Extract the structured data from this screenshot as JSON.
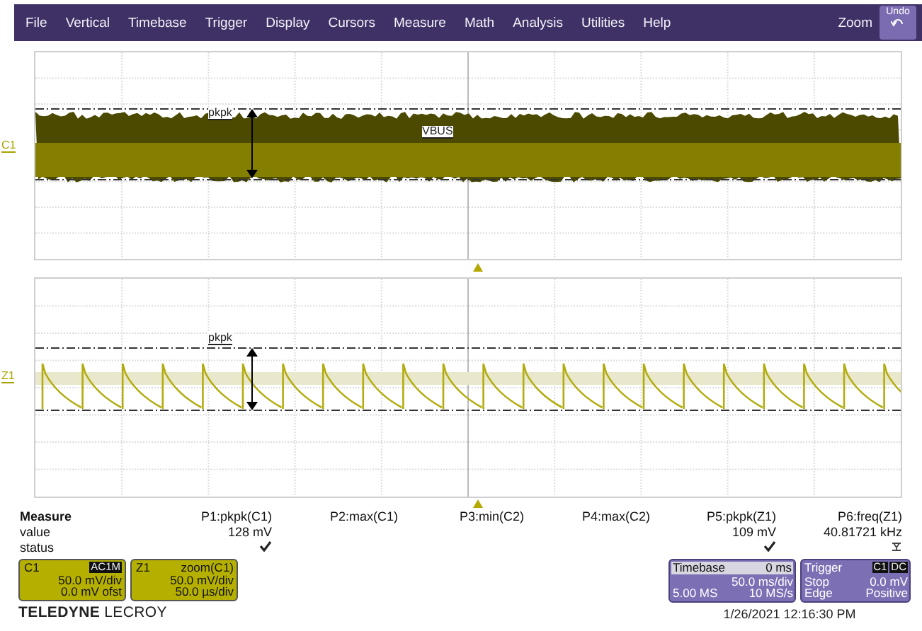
{
  "menu": {
    "items": [
      "File",
      "Vertical",
      "Timebase",
      "Trigger",
      "Display",
      "Cursors",
      "Measure",
      "Math",
      "Analysis",
      "Utilities",
      "Help"
    ],
    "zoom": "Zoom",
    "undo": "Undo"
  },
  "panels": [
    {
      "trace": "C1",
      "kind": "noise",
      "annotations": [
        {
          "text": "pkpk",
          "kind": "measure"
        },
        {
          "text": "VBUS",
          "kind": "trace"
        }
      ]
    },
    {
      "trace": "Z1",
      "kind": "sawtooth",
      "annotations": [
        {
          "text": "pkpk",
          "kind": "measure"
        }
      ]
    }
  ],
  "measure": {
    "title": "Measure",
    "row_labels": [
      "value",
      "status"
    ],
    "params": [
      {
        "name": "P1:pkpk(C1)",
        "value": "128 mV",
        "kind": "check"
      },
      {
        "name": "P2:max(C1)",
        "kind": "plain"
      },
      {
        "name": "P3:min(C2)",
        "kind": "plain"
      },
      {
        "name": "P4:max(C2)",
        "kind": "plain"
      },
      {
        "name": "P5:pkpk(Z1)",
        "value": "109 mV",
        "kind": "check"
      },
      {
        "name": "P6:freq(Z1)",
        "value": "40.81721 kHz",
        "kind": "unstable"
      }
    ]
  },
  "channel_badges": [
    {
      "name": "C1",
      "tag": "AC1M",
      "lines": [
        "50.0 mV/div",
        "0.0 mV ofst"
      ],
      "color": "#b5b000"
    },
    {
      "name": "Z1",
      "tag": "zoom(C1)",
      "lines": [
        "50.0 mV/div",
        "50.0 µs/div"
      ],
      "color": "#b5b000"
    }
  ],
  "timebase": {
    "title": "Timebase",
    "delay": "0 ms",
    "scale": "50.0 ms/div",
    "samples": "5.00 MS",
    "rate": "10 MS/s"
  },
  "trigger": {
    "title": "Trigger",
    "source": "C1",
    "coupling": "DC",
    "mode": "Stop",
    "level": "0.0 mV",
    "type": "Edge",
    "slope": "Positive"
  },
  "logo": {
    "brand": "TELEDYNE",
    "name": "LECROY"
  },
  "timestamp": "1/26/2021 12:16:30 PM"
}
